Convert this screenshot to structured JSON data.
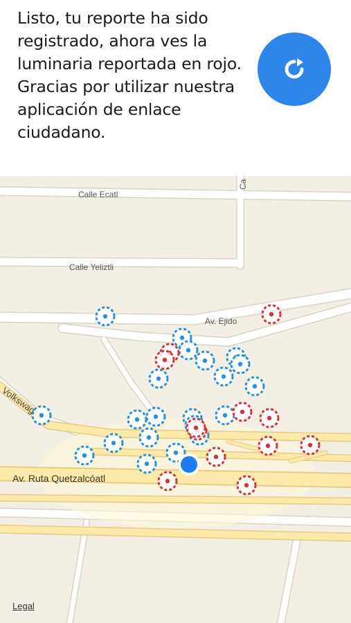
{
  "header": {
    "message": "Listo, tu reporte ha sido registrado, ahora ves la luminaria reportada en rojo. Gracias por utilizar nuestra aplicación de enlace ciudadano.",
    "refresh_icon": "refresh-icon",
    "accent_color": "#2f86ea"
  },
  "map": {
    "streets": {
      "calle_ecatl": "Calle Ecatl",
      "calle_yeliztli": "Calle Yeliztli",
      "av_ejido": "Av. Ejido",
      "volkswagen": "Volkswagen",
      "av_ruta_quetzalcoatl": "Av. Ruta Quetzalcóatl",
      "ca": "Ca"
    },
    "legal": "Legal",
    "colors": {
      "reported": "#d0343a",
      "working": "#2b8fd4",
      "user_location": "#1d7cf2"
    }
  }
}
